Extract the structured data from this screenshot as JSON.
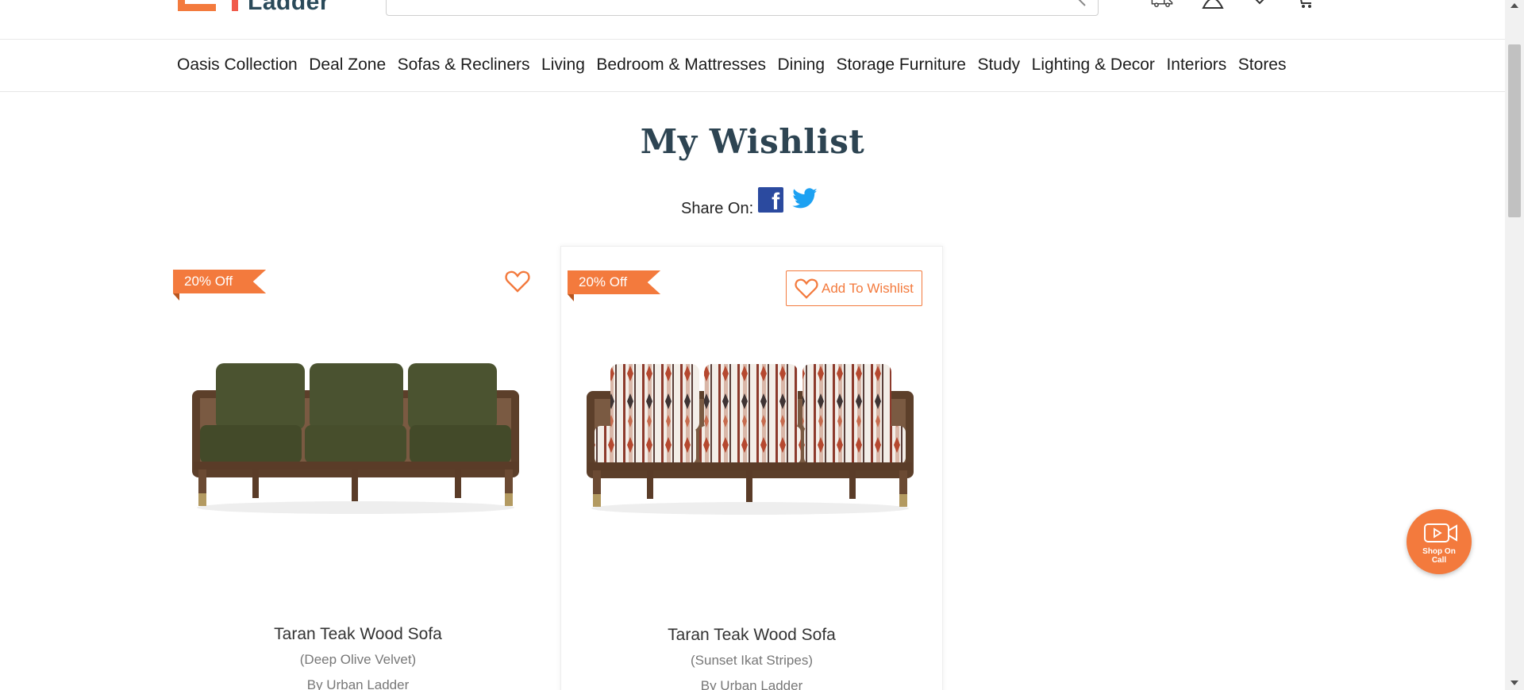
{
  "brand": {
    "logo_text": "Ladder"
  },
  "search": {
    "placeholder": ""
  },
  "nav": {
    "items": [
      "Oasis Collection",
      "Deal Zone",
      "Sofas & Recliners",
      "Living",
      "Bedroom & Mattresses",
      "Dining",
      "Storage Furniture",
      "Study",
      "Lighting & Decor",
      "Interiors",
      "Stores"
    ]
  },
  "page": {
    "title": "My Wishlist",
    "share_label": "Share On:"
  },
  "products": [
    {
      "badge": "20% Off",
      "name": "Taran Teak Wood Sofa",
      "variant": "(Deep Olive Velvet)",
      "brand": "By Urban Ladder",
      "wishlisted": true
    },
    {
      "badge": "20% Off",
      "name": "Taran Teak Wood Sofa",
      "variant": "(Sunset Ikat Stripes)",
      "brand": "By Urban Ladder",
      "wishlisted": false,
      "wishlist_label": "Add To Wishlist"
    }
  ],
  "floating": {
    "line1": "Shop On",
    "line2": "Call"
  },
  "colors": {
    "accent": "#f37a3d",
    "title": "#2d4452",
    "facebook": "#2b4a9f",
    "twitter": "#1da1f2"
  }
}
